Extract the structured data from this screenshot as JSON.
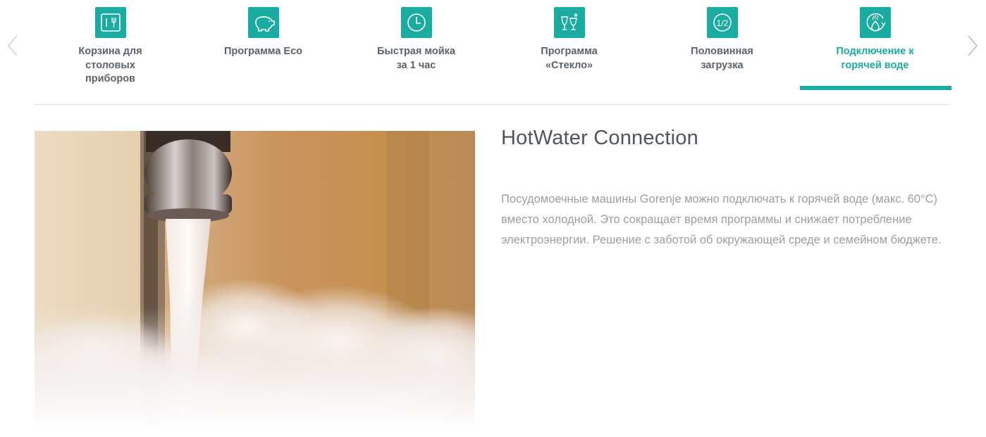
{
  "nav": {
    "prev_icon": "chevron-left-icon",
    "next_icon": "chevron-right-icon"
  },
  "tabs": [
    {
      "label": "Корзина для\nстоловых\nприборов",
      "icon": "cutlery-basket-icon",
      "active": false
    },
    {
      "label": "Программа Eco",
      "icon": "piggy-bank-icon",
      "active": false
    },
    {
      "label": "Быстрая мойка\nза 1 час",
      "icon": "clock-icon",
      "active": false
    },
    {
      "label": "Программа\n«Стекло»",
      "icon": "wine-glass-icon",
      "active": false
    },
    {
      "label": "Половинная\nзагрузка",
      "icon": "half-load-icon",
      "active": false
    },
    {
      "label": "Подключение к\nгорячей воде",
      "icon": "hot-water-icon",
      "active": true
    }
  ],
  "content": {
    "title": "HotWater Connection",
    "body": "Посудомоечные машины Gorenje можно подключать к горячей воде (макс. 60°C) вместо холодной. Это сокращает время программы и снижает потребление электроэнергии. Решение с заботой об окружающей среде и семейном бюджете.",
    "image": "hot-water-tap-photo"
  },
  "colors": {
    "accent": "#1aaca1",
    "tab_text": "#5b636a",
    "title": "#4e565c",
    "body": "#9a9fa3"
  }
}
